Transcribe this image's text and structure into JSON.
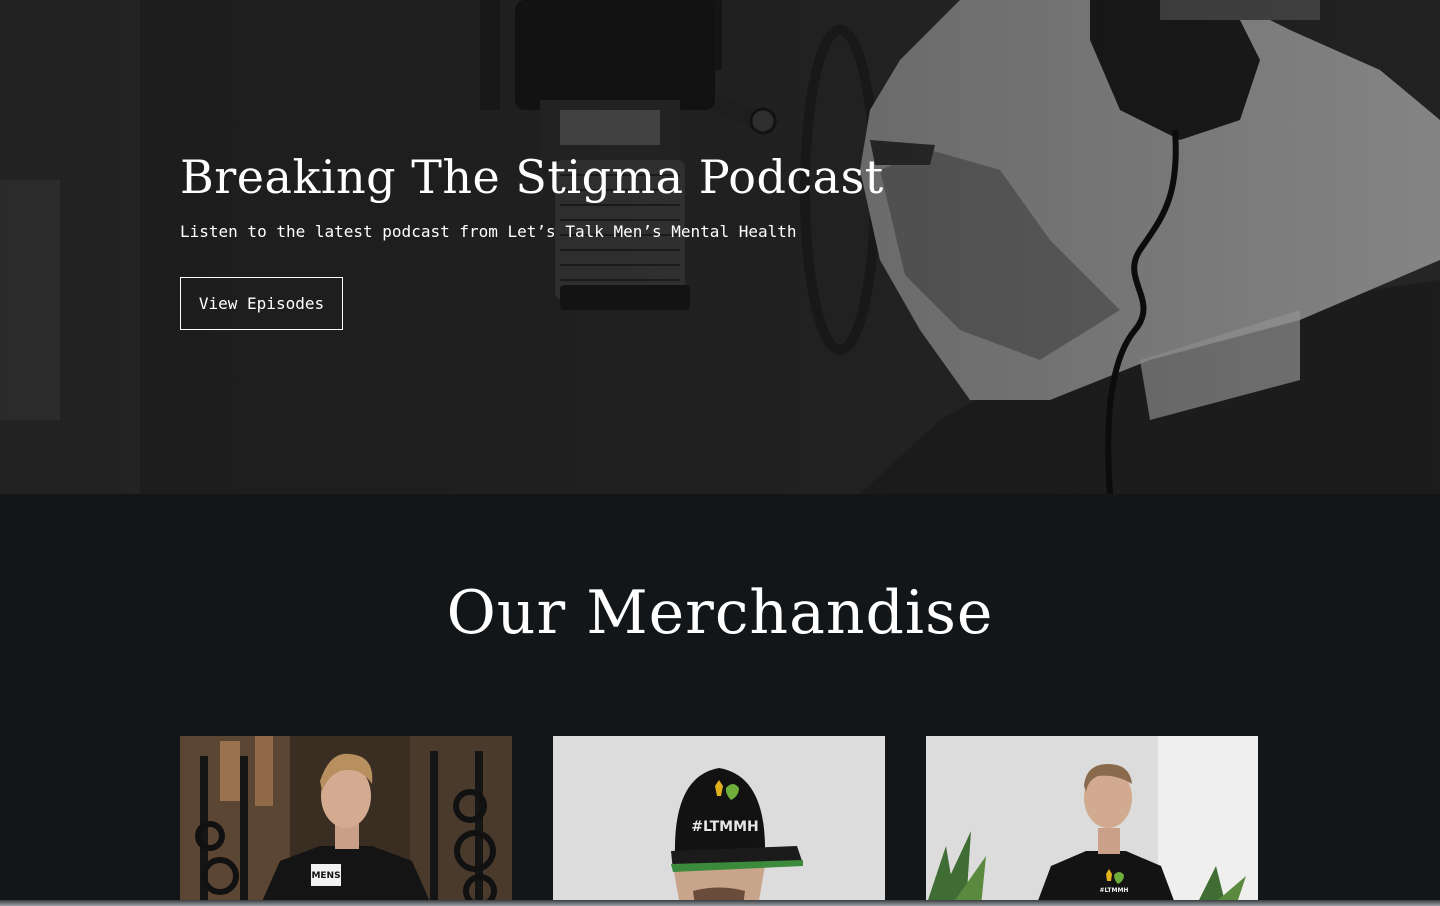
{
  "hero": {
    "title": "Breaking The Stigma Podcast",
    "subtitle": "Listen to the latest podcast from Let’s Talk Men’s Mental Health",
    "button_label": "View Episodes"
  },
  "merch": {
    "title": "Our Merchandise",
    "products": [
      {
        "image": "man-in-gym-wearing-black-mens-mental-health-tshirt",
        "shirt_text": "MENS"
      },
      {
        "image": "man-wearing-black-ltmmh-snapback-cap",
        "cap_text": "#LTMMH"
      },
      {
        "image": "man-wearing-black-tshirt-with-ltmmh-logo",
        "shirt_text": "#LTMMH"
      }
    ]
  },
  "colors": {
    "page_background": "#121619",
    "text": "#ffffff",
    "logo_yellow": "#e2b21c",
    "logo_green": "#6fae3a"
  }
}
